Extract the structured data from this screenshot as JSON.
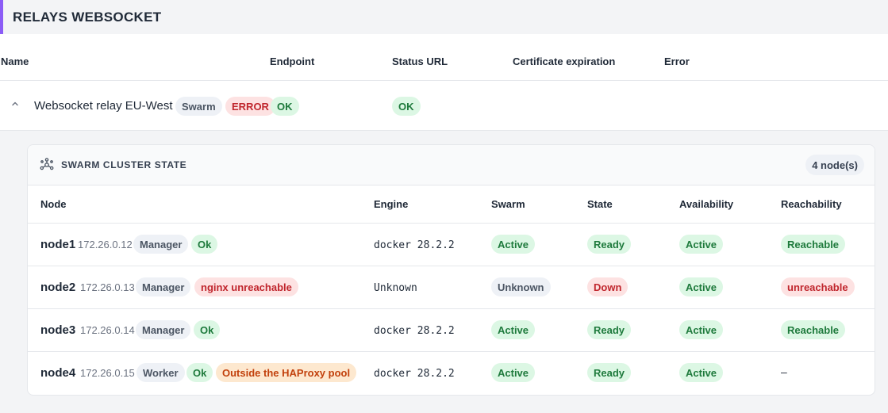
{
  "section": {
    "title": "RELAYS WEBSOCKET"
  },
  "relay_table": {
    "headers": {
      "name": "Name",
      "endpoint": "Endpoint",
      "status_url": "Status URL",
      "cert": "Certificate expiration",
      "error": "Error"
    },
    "row": {
      "name": "Websocket relay EU-West",
      "type_badge": "Swarm",
      "error_badge": "ERROR",
      "ok_badge": "OK",
      "status_url_badge": "OK"
    }
  },
  "cluster": {
    "title": "SWARM CLUSTER STATE",
    "node_count": "4 node(s)",
    "headers": {
      "node": "Node",
      "engine": "Engine",
      "swarm": "Swarm",
      "state": "State",
      "availability": "Availability",
      "reachability": "Reachability"
    },
    "nodes": [
      {
        "name": "node1",
        "ip": "172.26.0.12",
        "role": "Manager",
        "status": "Ok",
        "engine": "docker 28.2.2",
        "swarm": "Active",
        "state": "Ready",
        "availability": "Active",
        "reachability": "Reachable"
      },
      {
        "name": "node2",
        "ip": "172.26.0.13",
        "role": "Manager",
        "status": "nginx unreachable",
        "engine": "Unknown",
        "swarm": "Unknown",
        "state": "Down",
        "availability": "Active",
        "reachability": "unreachable"
      },
      {
        "name": "node3",
        "ip": "172.26.0.14",
        "role": "Manager",
        "status": "Ok",
        "engine": "docker 28.2.2",
        "swarm": "Active",
        "state": "Ready",
        "availability": "Active",
        "reachability": "Reachable"
      },
      {
        "name": "node4",
        "ip": "172.26.0.15",
        "role": "Worker",
        "status": "Ok",
        "extra": "Outside the HAProxy pool",
        "engine": "docker 28.2.2",
        "swarm": "Active",
        "state": "Ready",
        "availability": "Active",
        "reachability": "–"
      }
    ]
  },
  "colors": {
    "accent": "#8b5cf6",
    "ok": "#1e7a3c",
    "error": "#c0262d",
    "warning": "#c2410c"
  },
  "icons": {
    "collapse": "chevron-up-icon",
    "cluster": "cluster-icon"
  }
}
